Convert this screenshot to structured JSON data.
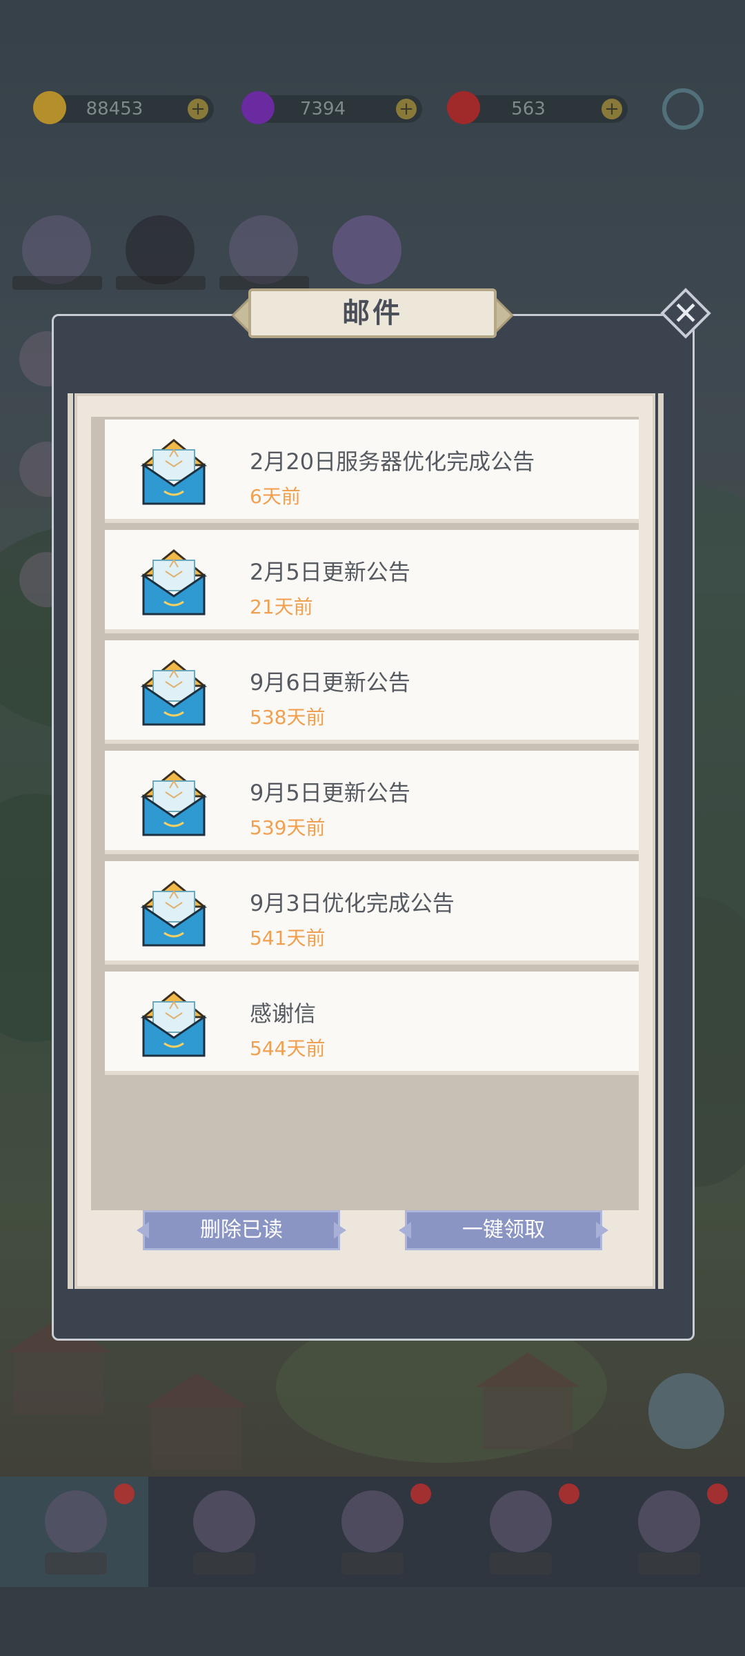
{
  "currency": [
    {
      "name": "gold",
      "value": "88453",
      "color": "#d4a830"
    },
    {
      "name": "gem",
      "value": "7394",
      "color": "#8a3ad0"
    },
    {
      "name": "ruby",
      "value": "563",
      "color": "#d03a3a"
    }
  ],
  "dialog": {
    "title": "邮件",
    "close_icon": "close-x-icon"
  },
  "mails": [
    {
      "subject": "2月20日服务器优化完成公告",
      "age": "6天前",
      "icon": "envelope-icon"
    },
    {
      "subject": "2月5日更新公告",
      "age": "21天前",
      "icon": "envelope-icon"
    },
    {
      "subject": "9月6日更新公告",
      "age": "538天前",
      "icon": "envelope-icon"
    },
    {
      "subject": "9月5日更新公告",
      "age": "539天前",
      "icon": "envelope-icon"
    },
    {
      "subject": "9月3日优化完成公告",
      "age": "541天前",
      "icon": "envelope-icon"
    },
    {
      "subject": "感谢信",
      "age": "544天前",
      "icon": "envelope-icon"
    }
  ],
  "actions": {
    "delete_read": "删除已读",
    "claim_all": "一键领取"
  },
  "colors": {
    "age_text": "#f0a050",
    "button": "#8b95c4",
    "panel": "#3b434e"
  }
}
